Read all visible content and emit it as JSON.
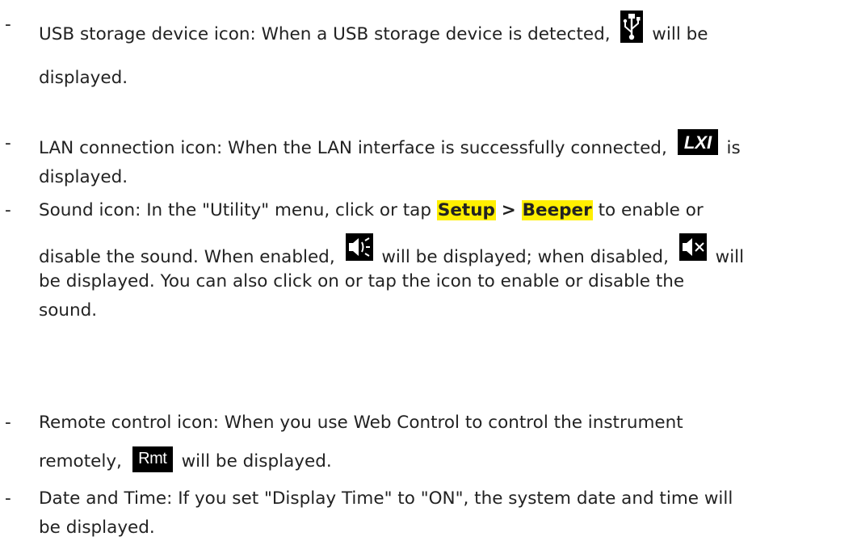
{
  "bullet_marker": "-",
  "items": [
    {
      "before_icon": "USB storage device icon: When a USB storage device is detected,",
      "icon": "usb-icon",
      "after_icon": "will be",
      "line2": "displayed."
    },
    {
      "before_icon": "LAN connection icon: When the LAN interface is successfully connected,",
      "icon": "lxi-icon",
      "icon_text": "LXI",
      "after_icon": "is",
      "line2": "displayed."
    },
    {
      "line1_a": "Sound icon: In the \"Utility\" menu, click or tap",
      "menu_setup": "Setup",
      "separator": ">",
      "menu_beeper": "Beeper",
      "line1_b": "to enable or",
      "line2_a": "disable the sound. When enabled,",
      "icon_enabled": "speaker-on-icon",
      "line2_b": "will be displayed; when disabled,",
      "icon_disabled": "speaker-mute-icon",
      "line2_c": "will",
      "line3": "be displayed. You can also click on or tap the icon to enable or disable the",
      "line4": "sound."
    },
    {
      "line1": "Remote control icon: When you use Web Control to control the instrument",
      "line2_a": "remotely,",
      "icon": "rmt-icon",
      "icon_text": "Rmt",
      "line2_b": "will be displayed."
    },
    {
      "line1": "Date and Time: If you set \"Display Time\" to \"ON\", the system date and time will",
      "line2": "be displayed."
    }
  ]
}
